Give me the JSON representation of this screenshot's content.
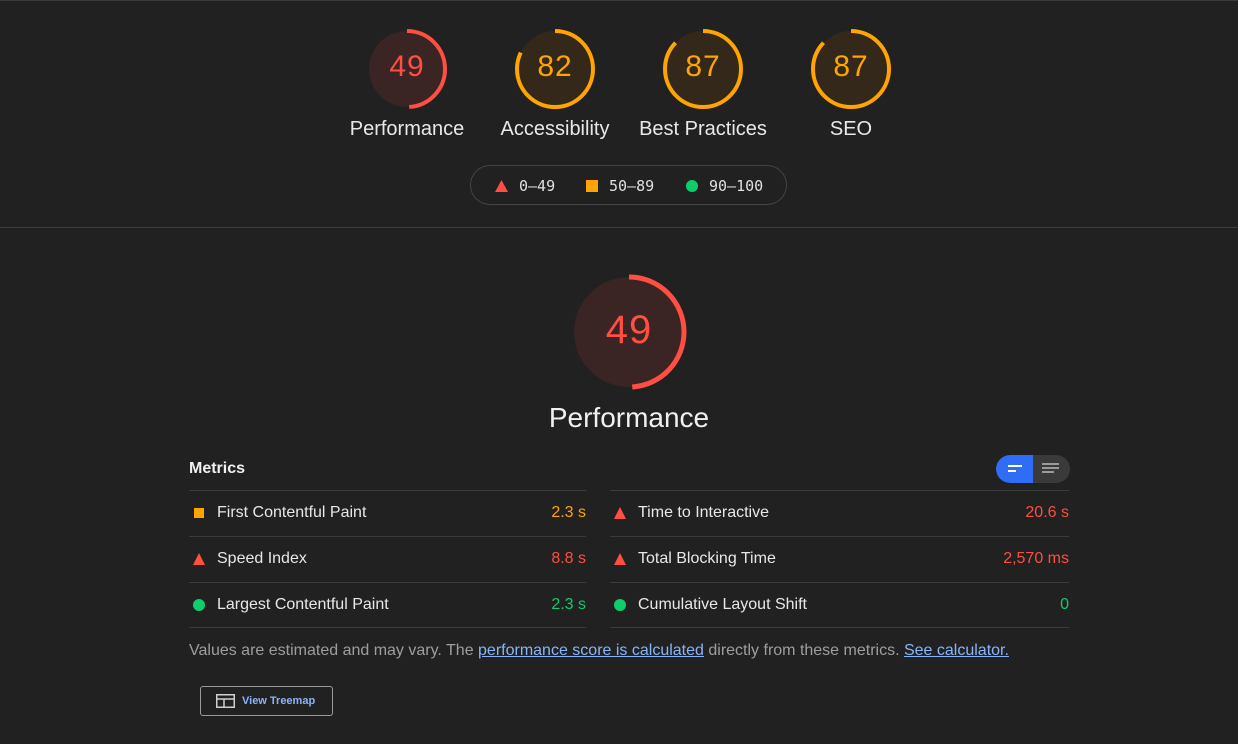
{
  "categories": [
    {
      "score": "49",
      "label": "Performance",
      "color": "#ff4e42",
      "fill": "#3a2424",
      "fraction": 0.49
    },
    {
      "score": "82",
      "label": "Accessibility",
      "color": "#ffa400",
      "fill": "#33281a",
      "fraction": 0.82
    },
    {
      "score": "87",
      "label": "Best Practices",
      "color": "#ffa400",
      "fill": "#33281a",
      "fraction": 0.87
    },
    {
      "score": "87",
      "label": "SEO",
      "color": "#ffa400",
      "fill": "#33281a",
      "fraction": 0.87
    }
  ],
  "legend": {
    "fail": "0–49",
    "average": "50–89",
    "pass": "90–100"
  },
  "main": {
    "score": "49",
    "title": "Performance",
    "fraction": 0.49,
    "color": "#ff4e42"
  },
  "metrics": {
    "heading": "Metrics",
    "left": [
      {
        "name": "First Contentful Paint",
        "value": "2.3 s",
        "status": "average"
      },
      {
        "name": "Speed Index",
        "value": "8.8 s",
        "status": "fail"
      },
      {
        "name": "Largest Contentful Paint",
        "value": "2.3 s",
        "status": "pass"
      }
    ],
    "right": [
      {
        "name": "Time to Interactive",
        "value": "20.6 s",
        "status": "fail"
      },
      {
        "name": "Total Blocking Time",
        "value": "2,570 ms",
        "status": "fail"
      },
      {
        "name": "Cumulative Layout Shift",
        "value": "0",
        "status": "pass"
      }
    ]
  },
  "note": {
    "prefix": "Values are estimated and may vary. The ",
    "link1": "performance score is calculated",
    "middle": " directly from these metrics. ",
    "link2": "See calculator."
  },
  "treemap_button": "View Treemap",
  "colors": {
    "fail": "#ff4e42",
    "average": "#ffa400",
    "pass": "#0cce6b",
    "accent": "#2f6df6"
  }
}
